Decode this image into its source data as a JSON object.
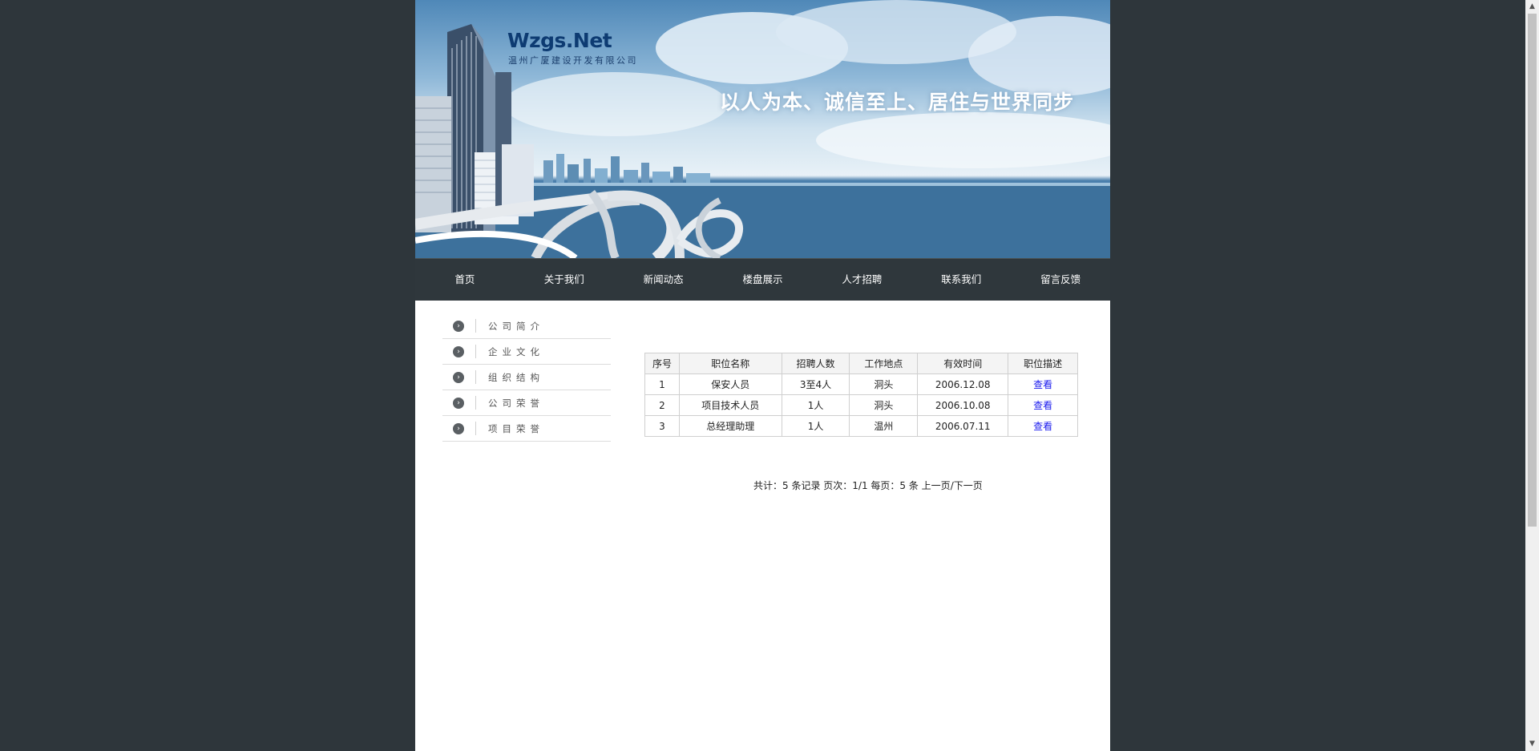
{
  "banner": {
    "logo_text": "Wzgs.Net",
    "company_name": "温州广厦建设开发有限公司",
    "slogan": "以人为本、诚信至上、居住与世界同步"
  },
  "nav": {
    "items": [
      {
        "label": "首页"
      },
      {
        "label": "关于我们"
      },
      {
        "label": "新闻动态"
      },
      {
        "label": "楼盘展示"
      },
      {
        "label": "人才招聘"
      },
      {
        "label": "联系我们"
      },
      {
        "label": "留言反馈"
      }
    ]
  },
  "sidebar": {
    "items": [
      {
        "label": "公司简介"
      },
      {
        "label": "企业文化"
      },
      {
        "label": "组织结构"
      },
      {
        "label": "公司荣誉"
      },
      {
        "label": "项目荣誉"
      }
    ]
  },
  "jobs_table": {
    "headers": [
      "序号",
      "职位名称",
      "招聘人数",
      "工作地点",
      "有效时间",
      "职位描述"
    ],
    "rows": [
      {
        "no": "1",
        "title": "保安人员",
        "count": "3至4人",
        "location": "洞头",
        "valid": "2006.12.08",
        "desc": "查看"
      },
      {
        "no": "2",
        "title": "项目技术人员",
        "count": "1人",
        "location": "洞头",
        "valid": "2006.10.08",
        "desc": "查看"
      },
      {
        "no": "3",
        "title": "总经理助理",
        "count": "1人",
        "location": "温州",
        "valid": "2006.07.11",
        "desc": "查看"
      }
    ]
  },
  "pager": {
    "summary": "共计：5 条记录 页次：1/1 每页：5 条",
    "prev": "上一页",
    "separator": "/",
    "next": "下一页"
  }
}
